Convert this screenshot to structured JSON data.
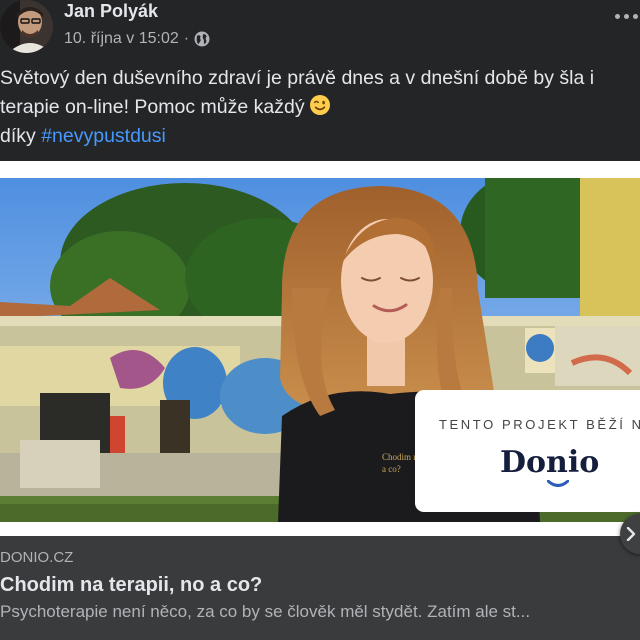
{
  "post": {
    "author": "Jan Polyák",
    "timestamp": "10. října v 15:02",
    "separator": "·",
    "audience_icon": "globe-icon",
    "text_lines": [
      "Světový den duševního zdraví je právě dnes a v dnešní době by šla i",
      "terapie on-line! Pomoc může každý"
    ],
    "text_emoji": "winking-face-emoji",
    "text_line3_prefix": "díky",
    "hashtag": "#nevypustdusi"
  },
  "photo_badge": {
    "top_text": "TENTO PROJEKT BĚŽÍ N",
    "logo_text": "Donio"
  },
  "link_preview": {
    "domain": "DONIO.CZ",
    "title": "Chodim na terapii, no a co?",
    "description": "Psychoterapie není něco, za co by se člověk měl stydět. Zatím ale st..."
  },
  "colors": {
    "background": "#242526",
    "link_box": "#3a3b3c",
    "hashtag": "#4599ff",
    "text_primary": "#e4e6eb",
    "text_secondary": "#b0b3b8"
  }
}
